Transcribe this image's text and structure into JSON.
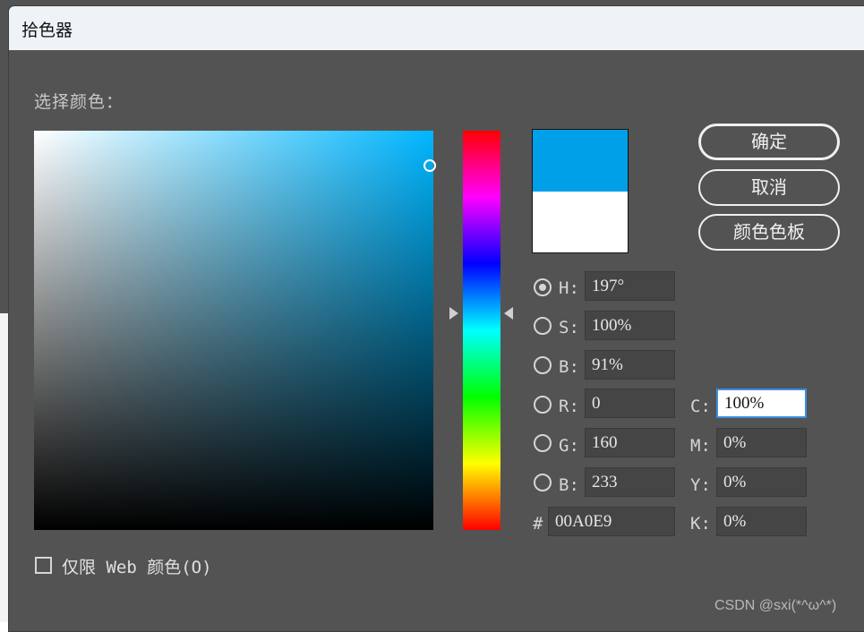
{
  "window": {
    "title": "拾色器"
  },
  "picker": {
    "select_label": "选择颜色：",
    "new_color": "#00a0e9",
    "old_color": "#ffffff",
    "field_hue_color": "#00b6ff"
  },
  "buttons": {
    "ok": "确定",
    "cancel": "取消",
    "swatches": "颜色色板"
  },
  "hsb": {
    "h_label": "H:",
    "h_value": "197°",
    "s_label": "S:",
    "s_value": "100%",
    "b_label": "B:",
    "b_value": "91%"
  },
  "rgb": {
    "r_label": "R:",
    "r_value": "0",
    "g_label": "G:",
    "g_value": "160",
    "b_label": "B:",
    "b_value": "233"
  },
  "hex": {
    "label": "#",
    "value": "00A0E9"
  },
  "cmyk": {
    "c_label": "C:",
    "c_value": "100%",
    "m_label": "M:",
    "m_value": "0%",
    "y_label": "Y:",
    "y_value": "0%",
    "k_label": "K:",
    "k_value": "0%"
  },
  "web_only": {
    "label": "仅限 Web 颜色(O)",
    "checked": false
  },
  "watermark": "CSDN @sxi(*^ω^*)"
}
